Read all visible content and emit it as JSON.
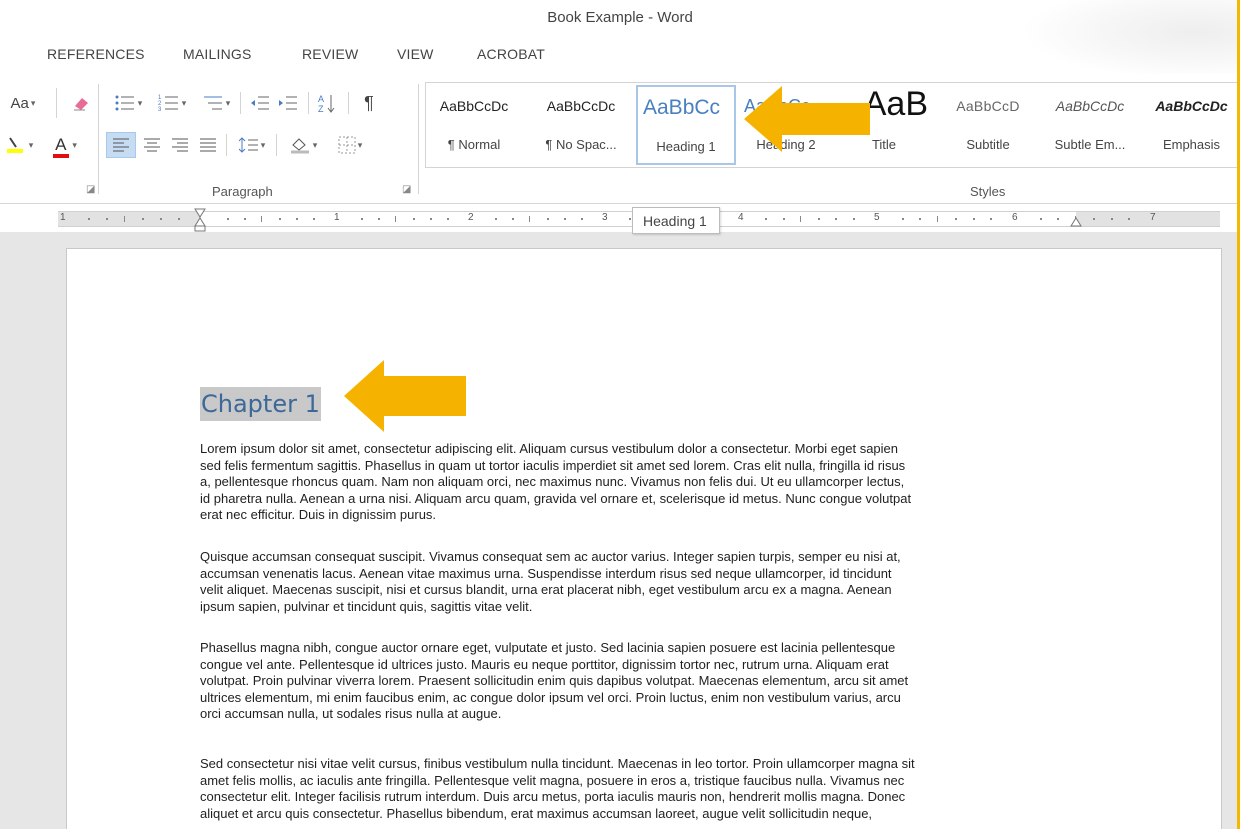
{
  "window": {
    "title": "Book Example - Word"
  },
  "tabs": [
    {
      "label": "REFERENCES"
    },
    {
      "label": "MAILINGS"
    },
    {
      "label": "REVIEW"
    },
    {
      "label": "VIEW"
    },
    {
      "label": "ACROBAT"
    }
  ],
  "ribbon": {
    "font_group": {
      "change_case": "Aa",
      "font_color_letter": "A",
      "highlight_color": "#ffff00",
      "font_color": "#e01010"
    },
    "paragraph_group": {
      "label": "Paragraph",
      "show_marks": "¶"
    },
    "styles_group": {
      "label": "Styles",
      "items": [
        {
          "preview": "AaBbCcDc",
          "name": "¶ Normal"
        },
        {
          "preview": "AaBbCcDc",
          "name": "¶ No Spac..."
        },
        {
          "preview": "AaBbCc",
          "name": "Heading 1"
        },
        {
          "preview": "AaBbCc",
          "name": "Heading 2"
        },
        {
          "preview": "AaB",
          "name": "Title"
        },
        {
          "preview": "AaBbCcD",
          "name": "Subtitle"
        },
        {
          "preview": "AaBbCcDc",
          "name": "Subtle Em..."
        },
        {
          "preview": "AaBbCcDc",
          "name": "Emphasis"
        }
      ],
      "selected": "Heading 1"
    }
  },
  "ruler": {
    "numbers": [
      "1",
      "1",
      "2",
      "3",
      "4",
      "5",
      "6",
      "7"
    ]
  },
  "tooltip": {
    "text": "Heading 1"
  },
  "document": {
    "heading": "Chapter 1",
    "paragraphs": [
      "Lorem ipsum dolor sit amet, consectetur adipiscing elit. Aliquam cursus vestibulum dolor a consectetur. Morbi eget sapien\nsed felis fermentum sagittis. Phasellus in quam ut tortor iaculis imperdiet sit amet sed lorem. Cras elit nulla, fringilla id risus\na, pellentesque rhoncus quam. Nam non aliquam orci, nec maximus nunc. Vivamus non felis dui. Ut eu ullamcorper lectus,\nid pharetra nulla. Aenean a urna nisi. Aliquam arcu quam, gravida vel ornare et, scelerisque id metus. Nunc congue volutpat\nerat nec efficitur. Duis in dignissim purus.",
      "Quisque accumsan consequat suscipit. Vivamus consequat sem ac auctor varius. Integer sapien turpis, semper eu nisi at,\naccumsan venenatis lacus. Aenean vitae maximus urna. Suspendisse interdum risus sed neque ullamcorper, id tincidunt\nvelit aliquet. Maecenas suscipit, nisi et cursus blandit, urna erat placerat nibh, eget vestibulum arcu ex a magna. Aenean\nipsum sapien, pulvinar et tincidunt quis, sagittis vitae velit.",
      "Phasellus magna nibh, congue auctor ornare eget, vulputate et justo. Sed lacinia sapien posuere est lacinia pellentesque\ncongue vel ante. Pellentesque id ultrices justo. Mauris eu neque porttitor, dignissim tortor nec, rutrum urna. Aliquam erat\nvolutpat. Proin pulvinar viverra lorem. Praesent sollicitudin enim quis dapibus volutpat. Maecenas elementum, arcu sit amet\nultrices elementum, mi enim faucibus enim, ac congue dolor ipsum vel orci. Proin luctus, enim non vestibulum varius, arcu\norci accumsan nulla, ut sodales risus nulla at augue.",
      "Sed consectetur nisi vitae velit cursus, finibus vestibulum nulla tincidunt. Maecenas in leo tortor. Proin ullamcorper magna sit\namet felis mollis, ac iaculis ante fringilla. Pellentesque velit magna, posuere in eros a, tristique faucibus nulla. Vivamus nec\nconsectetur elit. Integer facilisis rutrum interdum. Duis arcu metus, porta iaculis mauris non, hendrerit mollis magna. Donec\naliquet et arcu quis consectetur. Phasellus bibendum, erat maximus accumsan laoreet, augue velit sollicitudin neque,"
    ]
  },
  "colors": {
    "heading_text": "#3d6899",
    "selection_bg": "#c9c9c9",
    "arrow": "#f5b300",
    "selected_style_border": "#a9c5e8"
  }
}
